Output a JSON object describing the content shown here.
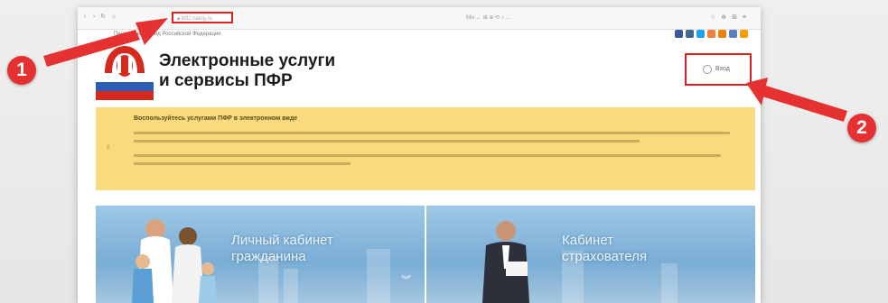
{
  "browser": {
    "address_text": "lkfl2.nalog.ru",
    "nav_icons": [
      "back-icon",
      "forward-icon",
      "reload-icon",
      "home-icon"
    ],
    "tabs_center": "Mix  ←  ⊞  ⊕  ⟲  ⌂ ...",
    "right_icons": "☆ ⊕ ⊞ ≡"
  },
  "site": {
    "crumb": "Пенсионный фонд Российской Федерации",
    "title_line1": "Электронные услуги",
    "title_line2": "и сервисы ПФР",
    "login_label": "Вход",
    "social_colors": [
      "#3b5998",
      "#45668e",
      "#1da1f2",
      "#f0803c",
      "#ee8208",
      "#5a7fc1",
      "#f4a100"
    ]
  },
  "notice": {
    "heading": "Воспользуйтесь услугами ПФР в электронном виде",
    "bg": "#f9db7e"
  },
  "banners": [
    {
      "label_line1": "Личный кабинет",
      "label_line2": "гражданина"
    },
    {
      "label_line1": "Кабинет",
      "label_line2": "страхователя"
    }
  ],
  "markers": {
    "first": "1",
    "second": "2",
    "color": "#e53131"
  }
}
